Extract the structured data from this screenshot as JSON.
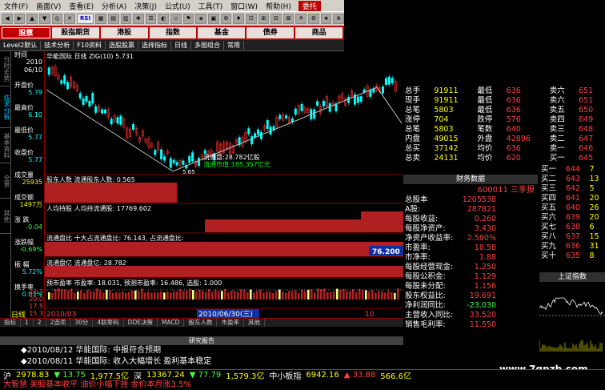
{
  "menu": [
    "文件(F)",
    "画面(V)",
    "查看(E)",
    "分析(A)",
    "决策(J)",
    "公式(U)",
    "工具(T)",
    "窗口(W)",
    "帮助(H)",
    "委托"
  ],
  "categories": [
    {
      "label": "股票",
      "on": true
    },
    {
      "label": "股指期货",
      "on": false
    },
    {
      "label": "港股",
      "on": false
    },
    {
      "label": "指数",
      "on": false
    },
    {
      "label": "基金",
      "on": false
    },
    {
      "label": "债券",
      "on": false
    },
    {
      "label": "商品",
      "on": false
    }
  ],
  "tabs": [
    "Level2默认",
    "技术分析",
    "F10资料",
    "选股股票",
    "选择指标",
    "日线",
    "多图组合",
    "常用"
  ],
  "vertical_tabs": [
    {
      "label": "分时走势",
      "on": false
    },
    {
      "label": "技术分析",
      "on": true
    },
    {
      "label": "基本资料",
      "on": false
    },
    {
      "label": "全景",
      "on": false
    },
    {
      "label": "其他",
      "on": false
    }
  ],
  "left_panel": [
    {
      "label": "时间",
      "value": "2010",
      "value2": "06/10"
    },
    {
      "label": "开盘价",
      "value": "5.79"
    },
    {
      "label": "最高价",
      "value": "6.10"
    },
    {
      "label": "最低价",
      "value": "5.77"
    },
    {
      "label": "收盘价",
      "value": "5.77"
    },
    {
      "label": "成交量",
      "value": "25935"
    },
    {
      "label": "成交额",
      "value": "1497万"
    },
    {
      "label": "涨 跌",
      "value": "-0.04"
    },
    {
      "label": "涨跌幅",
      "value": "-0.69%"
    },
    {
      "label": "振 幅",
      "value": "5.72%"
    },
    {
      "label": "换手率",
      "value": "0.03%"
    }
  ],
  "chart_header": "华能国际 日线 ZIG(10) 5.731",
  "chart_annotations": {
    "cap": "流通盘:28.782亿股",
    "mktcap": "流通市值:185.357亿元",
    "low_price": "5.65",
    "shareholders": "股东人数 流通股东人数: 0.565",
    "per_holder": "人均持股 人均持流通股: 17769.602",
    "float_ratio": "流通盘比 十大占流通盘比: 76.143, 占流通盘比:",
    "float_value": "76.200",
    "float_cap": "流通盘亿 流通盘亿: 28.782",
    "pe_line": "预市盈率 市盈率: 18.031, 预测市盈率: 16.486, 选股: 1.000",
    "y_top": "22.3",
    "y_mid": "20.0",
    "y_bot": "17.5",
    "y_low": "15.3"
  },
  "date_axis": [
    "2010/03",
    "2010/06/30(三)",
    "10"
  ],
  "left_axis_label": "日线",
  "bottom_tabs": [
    "指标",
    "1",
    "2",
    "2选项",
    "30分",
    "4联筹码",
    "DDE决策",
    "MACD",
    "股东人数",
    "市盈率",
    "其他"
  ],
  "order_book": [
    {
      "l": "总手",
      "v": "91911",
      "l2": "最低",
      "p": "636",
      "s": "卖六",
      "q": "651"
    },
    {
      "l": "现手",
      "v": "91911",
      "l2": "最低",
      "p": "636",
      "s": "卖六",
      "q": "651"
    },
    {
      "l": "总笔",
      "v": "5803",
      "l2": "最低",
      "p": "636",
      "s": "卖五",
      "q": "650"
    },
    {
      "l": "涨停",
      "v": "704",
      "l2": "跌停",
      "p": "576",
      "s": "卖四",
      "q": "649"
    },
    {
      "l": "总笔",
      "v": "5803",
      "l2": "笔数",
      "p": "640",
      "s": "卖三",
      "q": "648"
    },
    {
      "l": "内盘",
      "v": "49015",
      "l2": "外盘",
      "p": "42896",
      "s": "卖二",
      "q": "647"
    },
    {
      "l": "总买",
      "v": "37142",
      "l2": "均价",
      "p": "636",
      "s": "卖一",
      "q": "646"
    },
    {
      "l": "总卖",
      "v": "24131",
      "l2": "均价",
      "p": "620",
      "s": "买一",
      "q": "645"
    }
  ],
  "buy_side": [
    {
      "s": "买一",
      "q": "644"
    },
    {
      "s": "买二",
      "q": "643"
    },
    {
      "s": "买三",
      "q": "642"
    },
    {
      "s": "买四",
      "q": "641"
    },
    {
      "s": "买五",
      "q": "640"
    },
    {
      "s": "买六",
      "q": "639"
    },
    {
      "s": "买七",
      "q": "638"
    },
    {
      "s": "买八",
      "q": "637"
    },
    {
      "s": "买九",
      "q": "636"
    },
    {
      "s": "买十",
      "q": "635"
    }
  ],
  "buy_vol": [
    "7",
    "13",
    "5",
    "20",
    "26",
    "20",
    "6",
    "15",
    "31",
    "8"
  ],
  "fin_header": "财务数据",
  "fin_code": "600011 三季报",
  "fin_rows": [
    {
      "l": "总股本",
      "v": "1205538"
    },
    {
      "l": "A股:",
      "v": "287821"
    },
    {
      "l": "每股收益:",
      "v": "0.260"
    },
    {
      "l": "每股净资产:",
      "v": "3.430"
    },
    {
      "l": "净资产收益率:",
      "v": "2.580%"
    },
    {
      "l": "市盈率:",
      "v": "18.58"
    },
    {
      "l": "市净率:",
      "v": "1.88"
    },
    {
      "l": "每股经营现金:",
      "v": "1.250"
    },
    {
      "l": "每股公积金:",
      "v": "1.129"
    },
    {
      "l": "每股未分配:",
      "v": "1.156"
    },
    {
      "l": "股东权益比:",
      "v": "19.691"
    },
    {
      "l": "净利润同比:",
      "v": "-23.030"
    },
    {
      "l": "主营收入同比:",
      "v": "33.520"
    },
    {
      "l": "销售毛利率:",
      "v": "11.550"
    }
  ],
  "index_title": "上证指数",
  "report_header": "研究报告",
  "news": [
    {
      "date": "2010/08/12",
      "text": "华能国际: 中报符合预期"
    },
    {
      "date": "2010/08/11",
      "text": "华能国际: 收入大幅增长 盈利基本稳定"
    }
  ],
  "ticker": [
    {
      "t": "沪",
      "c": "#ffffff"
    },
    {
      "t": "2978.83",
      "c": "#ffff00"
    },
    {
      "t": "▼ 13.75",
      "c": "#40ff40"
    },
    {
      "t": "1,977.5亿",
      "c": "#ffff00"
    },
    {
      "t": "深",
      "c": "#ffffff"
    },
    {
      "t": "13367.24",
      "c": "#ffff00"
    },
    {
      "t": "▼ 77.79",
      "c": "#40ff40"
    },
    {
      "t": "1,579.3亿",
      "c": "#ffff00"
    },
    {
      "t": "中小板指",
      "c": "#ffffff"
    },
    {
      "t": "6942.16",
      "c": "#ffff00"
    },
    {
      "t": "▲ 33.88",
      "c": "#ff4040"
    },
    {
      "t": "566.6亿",
      "c": "#ffff00"
    }
  ],
  "ticker_news": "大智慧  美股基本收平 油价小幅下挫 金价本月涨3.5%",
  "watermark": "www.7gpzb.com"
}
